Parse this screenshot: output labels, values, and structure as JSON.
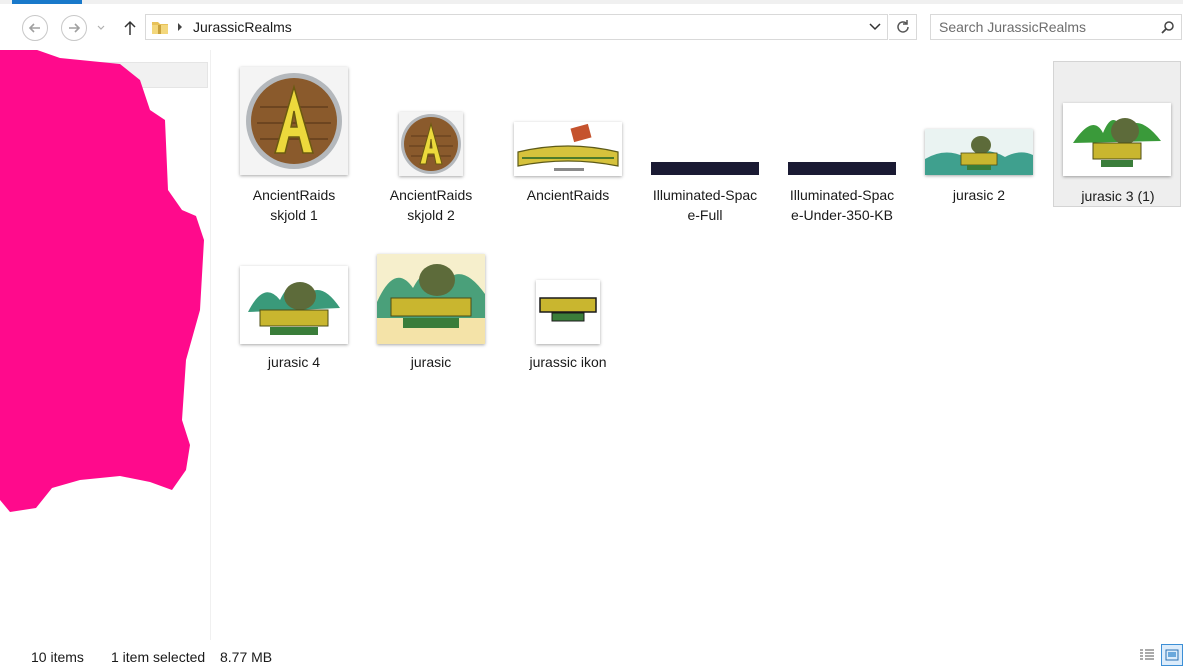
{
  "address": {
    "breadcrumb": "JurassicRealms"
  },
  "search": {
    "placeholder": "Search JurassicRealms"
  },
  "files": [
    {
      "label": "AncientRaids\nskjold 1",
      "thumb": "shield-large"
    },
    {
      "label": "AncientRaids\nskjold 2",
      "thumb": "shield-small"
    },
    {
      "label": "AncientRaids",
      "thumb": "ancientraids-logo"
    },
    {
      "label": "Illuminated-Spac\ne-Full",
      "thumb": "dark-banner"
    },
    {
      "label": "Illuminated-Spac\ne-Under-350-KB",
      "thumb": "dark-banner"
    },
    {
      "label": "jurasic 2",
      "thumb": "jurassic-banner"
    },
    {
      "label": "jurasic 3 (1)",
      "thumb": "jurassic-logo",
      "selected": true
    },
    {
      "label": "jurasic 4",
      "thumb": "jurassic-logo"
    },
    {
      "label": "jurasic",
      "thumb": "jurassic-logo-large"
    },
    {
      "label": "jurassic ikon",
      "thumb": "jurassic-icon"
    }
  ],
  "status": {
    "item_count": "10 items",
    "selection": "1 item selected",
    "size": "8.77 MB"
  },
  "colors": {
    "accent": "#1979ca",
    "redaction": "#ff0a8c"
  }
}
